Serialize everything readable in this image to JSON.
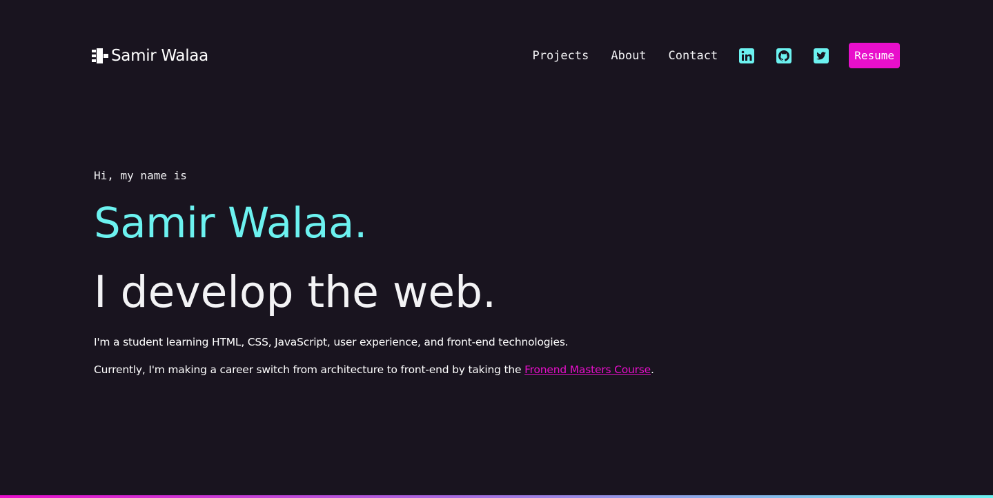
{
  "brand": {
    "name": "Samir Walaa",
    "logo_icon": "ui-slice-logo-icon"
  },
  "nav": {
    "links": [
      "Projects",
      "About",
      "Contact"
    ],
    "social": [
      {
        "name": "linkedin-icon"
      },
      {
        "name": "github-icon"
      },
      {
        "name": "twitter-icon"
      }
    ],
    "resume_label": "Resume"
  },
  "hero": {
    "intro": "Hi, my name is",
    "name": "Samir Walaa.",
    "tagline": "I develop the web.",
    "paragraph1": "I'm a student learning HTML, CSS, JavaScript, user experience, and front-end technologies.",
    "paragraph2_prefix": "Currently, I'm making a career switch from architecture to front-end by taking the ",
    "paragraph2_link": "Fronend Masters Course",
    "paragraph2_suffix": "."
  },
  "colors": {
    "background": "#19141f",
    "accent_cyan": "#6cf2f0",
    "accent_magenta": "#e80fcb",
    "text": "#f3f3f5"
  }
}
